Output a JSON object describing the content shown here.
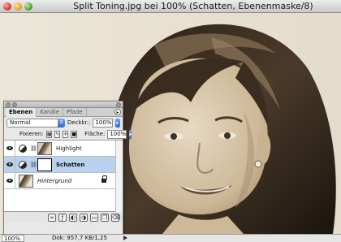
{
  "window": {
    "title": "Split Toning.jpg bei 100% (Schatten, Ebenenmaske/8)",
    "zoom": "100%",
    "doc_info": "Dok: 957,7 KB/1,25 MB"
  },
  "layers_panel": {
    "tabs": [
      {
        "label": "Ebenen",
        "active": true
      },
      {
        "label": "Kanäle",
        "active": false
      },
      {
        "label": "Pfade",
        "active": false
      }
    ],
    "blend_mode": "Normal",
    "opacity_label": "Deckkr.:",
    "opacity_value": "100%",
    "lock_label": "Fixieren:",
    "fill_label": "Fläche:",
    "fill_value": "100%",
    "layers": [
      {
        "name": "Highlight",
        "visible": true,
        "selected": false
      },
      {
        "name": "Schatten",
        "visible": true,
        "selected": true
      },
      {
        "name": "Hintergrund",
        "visible": true,
        "selected": false
      }
    ],
    "bottom_icons": [
      "link-icon",
      "style-icon",
      "mask-icon",
      "adjustment-icon",
      "folder-icon",
      "new-layer-icon",
      "trash-icon"
    ]
  },
  "colors": {
    "selected_row": "#b7d1ef",
    "accent_blue": "#2f6ad0",
    "photo_tone": "#e9e2d3"
  }
}
